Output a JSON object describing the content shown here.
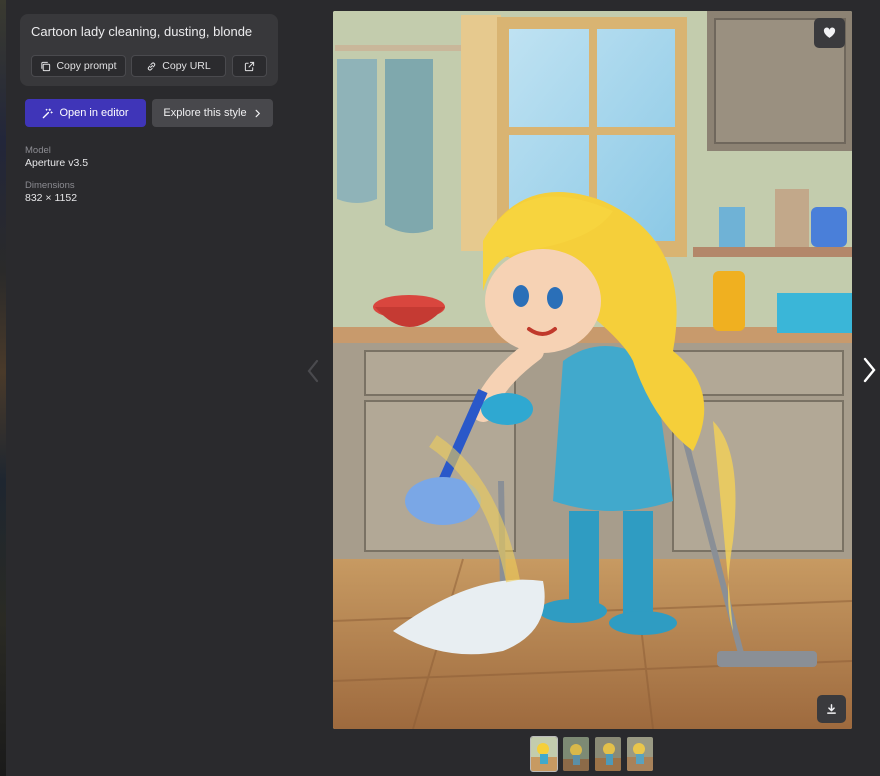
{
  "prompt": {
    "text": "Cartoon lady cleaning, dusting, blonde",
    "copy_prompt_label": "Copy prompt",
    "copy_url_label": "Copy URL"
  },
  "actions": {
    "open_editor_label": "Open in editor",
    "explore_style_label": "Explore this style"
  },
  "meta": {
    "model_label": "Model",
    "model_value": "Aperture v3.5",
    "dimensions_label": "Dimensions",
    "dimensions_value": "832 × 1152"
  },
  "icons": {
    "copy": "copy-icon",
    "link": "link-icon",
    "external": "external-link-icon",
    "editor": "magic-wand-icon",
    "explore": "chevron-right-icon",
    "favorite": "heart-icon",
    "download": "download-icon",
    "prev": "chevron-left-icon",
    "next": "chevron-right-icon"
  },
  "colors": {
    "panel_bg": "#2a2a2d",
    "card_bg": "#38383b",
    "primary_button": "#3f35b8",
    "secondary_button": "#48484c"
  },
  "thumbnails": [
    {
      "active": true
    },
    {
      "active": false
    },
    {
      "active": false
    },
    {
      "active": false
    }
  ]
}
